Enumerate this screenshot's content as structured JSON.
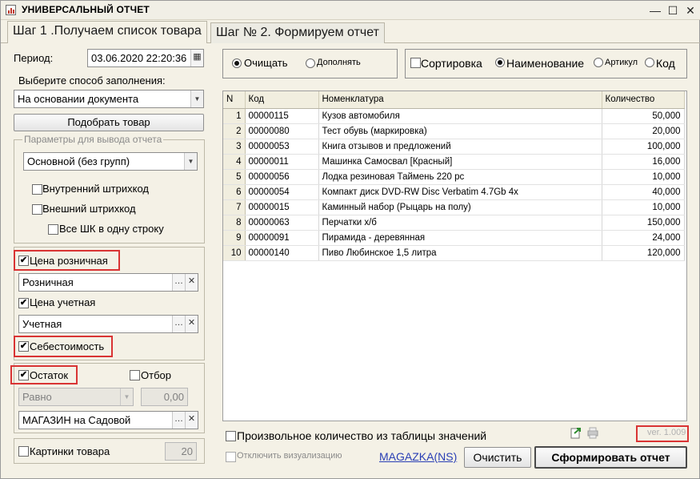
{
  "window": {
    "title": "УНИВЕРСАЛЬНЫЙ ОТЧЕТ",
    "minimize": "—",
    "maximize": "☐",
    "close": "✕"
  },
  "tabs": [
    {
      "label": "Шаг 1 .Получаем список товара",
      "active": true
    },
    {
      "label": "Шаг № 2. Формируем отчет",
      "active": false
    }
  ],
  "left": {
    "period_label": "Период:",
    "period_value": "03.06.2020 22:20:36",
    "fill_method_label": "Выберите способ заполнения:",
    "fill_method_value": "На основании документа",
    "pick_button": "Подобрать товар",
    "params_group_title": "Параметры для вывода отчета",
    "grouping_value": "Основной (без групп)",
    "internal_barcode": "Внутренний штрихкод",
    "external_barcode": "Внешний штрихкод",
    "all_barcodes_one_line": "Все ШК в одну строку",
    "retail_price_label": "Цена розничная",
    "retail_price_value": "Розничная",
    "account_price_label": "Цена учетная",
    "account_price_value": "Учетная",
    "cost_label": "Себестоимость",
    "stock_label": "Остаток",
    "filter_label": "Отбор",
    "compare_value": "Равно",
    "compare_number": "0,00",
    "warehouse_value": "МАГАЗИН на Садовой",
    "pictures_label": "Картинки товара",
    "pictures_count": "20"
  },
  "options": {
    "clear_label": "Очищать",
    "append_label": "Дополнять",
    "sort_label": "Сортировка",
    "by_name": "Наименование",
    "by_article": "Артикул",
    "by_code": "Код"
  },
  "table": {
    "columns": [
      "N",
      "Код",
      "Номенклатура",
      "Количество"
    ],
    "rows": [
      [
        "1",
        "00000115",
        "Кузов автомобиля",
        "50,000"
      ],
      [
        "2",
        "00000080",
        "Тест обувь (маркировка)",
        "20,000"
      ],
      [
        "3",
        "00000053",
        "Книга отзывов и предложений",
        "100,000"
      ],
      [
        "4",
        "00000011",
        "Машинка Самосвал [Красный]",
        "16,000"
      ],
      [
        "5",
        "00000056",
        "Лодка резиновая Таймень 220 pc",
        "10,000"
      ],
      [
        "6",
        "00000054",
        "Компакт диск DVD-RW Disc Verbatim 4.7Gb 4x",
        "40,000"
      ],
      [
        "7",
        "00000015",
        "Каминный набор (Рыцарь на полу)",
        "10,000"
      ],
      [
        "8",
        "00000063",
        "Перчатки х/б",
        "150,000"
      ],
      [
        "9",
        "00000091",
        "Пирамида - деревянная",
        "24,000"
      ],
      [
        "10",
        "00000140",
        "Пиво Любинское 1,5 литра",
        "120,000"
      ]
    ]
  },
  "bottom": {
    "arbitrary_qty_label": "Произвольное количество из таблицы значений",
    "disable_viz_label": "Отключить визуализацию",
    "link": "MAGAZKA(NS)",
    "clear_button": "Очистить",
    "generate_button": "Сформировать отчет",
    "version": "ver. 1.009"
  },
  "colors": {
    "background": "#f4f1e6",
    "highlight_box": "#d93434",
    "link": "#2a3fb5"
  }
}
